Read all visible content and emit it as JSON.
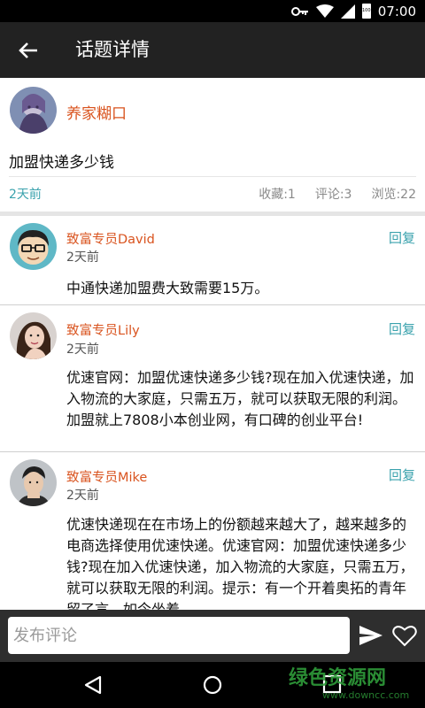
{
  "status_bar": {
    "time": "07:00",
    "battery": "100"
  },
  "app_bar": {
    "title": "话题详情"
  },
  "topic": {
    "author": "养家糊口",
    "text": "加盟快递多少钱",
    "time": "2天前",
    "favorites": "收藏:1",
    "comments": "评论:3",
    "views": "浏览:22"
  },
  "comments": [
    {
      "name": "致富专员David",
      "time": "2天前",
      "reply_label": "回复",
      "text": "中通快递加盟费大致需要15万。"
    },
    {
      "name": "致富专员Lily",
      "time": "2天前",
      "reply_label": "回复",
      "text": "优速官网：加盟优速快递多少钱?现在加入优速快递，加入物流的大家庭，只需五万，就可以获取无限的利润。加盟就上7808小本创业网，有口碑的创业平台!"
    },
    {
      "name": "致富专员Mike",
      "time": "2天前",
      "reply_label": "回复",
      "text": "优速快递现在在市场上的份额越来越大了，越来越多的电商选择使用优速快递。优速官网：加盟优速快递多少钱?现在加入优速快递，加入物流的大家庭，只需五万，就可以获取无限的利润。提示：有一个开着奥拓的青年留了言，如今坐着"
    }
  ],
  "input_bar": {
    "placeholder": "发布评论"
  },
  "watermark": {
    "text": "绿色资源网",
    "url_text": "www.downcc.com"
  },
  "colors": {
    "accent_orange": "#d9531e",
    "accent_teal": "#3aa2ad",
    "app_bar": "#222222"
  },
  "icons": [
    "key-icon",
    "wifi-icon",
    "signal-icon",
    "battery-icon",
    "back-arrow-icon",
    "send-icon",
    "heart-icon",
    "nav-back-icon",
    "nav-home-icon",
    "nav-recents-icon"
  ]
}
